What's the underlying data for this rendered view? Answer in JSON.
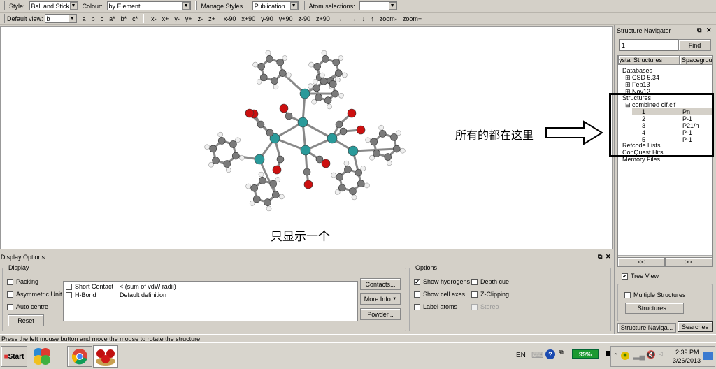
{
  "toolbar1": {
    "style_label": "Style:",
    "style_value": "Ball and Stick",
    "colour_label": "Colour:",
    "colour_value": "by Element",
    "manage_styles": "Manage Styles...",
    "manage_value": "Publication",
    "atom_sel_label": "Atom selections:",
    "atom_sel_value": ""
  },
  "toolbar2": {
    "default_view_label": "Default view:",
    "default_view_value": "b",
    "views": [
      "a",
      "b",
      "c",
      "a*",
      "b*",
      "c*"
    ],
    "rot": [
      "x-",
      "x+",
      "y-",
      "y+",
      "z-",
      "z+"
    ],
    "rot90": [
      "x-90",
      "x+90",
      "y-90",
      "y+90",
      "z-90",
      "z+90"
    ],
    "arrows": [
      "←",
      "→",
      "↓",
      "↑"
    ],
    "zoom": [
      "zoom-",
      "zoom+"
    ]
  },
  "annotations": {
    "right_note": "所有的都在这里",
    "bottom_note": "只显示一个"
  },
  "navigator": {
    "title": "Structure Navigator",
    "search_value": "1",
    "find": "Find",
    "col1": "ystal Structures",
    "col2": "Spacegroup",
    "databases": "Databases",
    "db_items": [
      "CSD 5.34",
      "Feb13",
      "Nov12"
    ],
    "structures": "Structures",
    "file": "combined cif.cif",
    "rows": [
      {
        "id": "1",
        "sg": "Pn"
      },
      {
        "id": "2",
        "sg": "P-1"
      },
      {
        "id": "3",
        "sg": "P21/n"
      },
      {
        "id": "4",
        "sg": "P-1"
      },
      {
        "id": "5",
        "sg": "P-1"
      }
    ],
    "refcode": "Refcode Lists",
    "conquest": "ConQuest Hits",
    "memory": "Memory Files",
    "prev": "<<",
    "next": ">>",
    "tree_view": "Tree View",
    "multiple": "Multiple Structures",
    "structures_btn": "Structures...",
    "tab1": "Structure Naviga...",
    "tab2": "Searches"
  },
  "display_options": {
    "title": "Display Options",
    "display_group": "Display",
    "packing": "Packing",
    "asym": "Asymmetric Unit",
    "auto_centre": "Auto centre",
    "reset": "Reset",
    "contacts": [
      {
        "name": "Short Contact",
        "def": "< (sum of vdW radii)"
      },
      {
        "name": "H-Bond",
        "def": "Default definition"
      }
    ],
    "contacts_btn": "Contacts...",
    "more_info": "More Info",
    "powder": "Powder...",
    "options_group": "Options",
    "show_h": "Show hydrogens",
    "depth": "Depth cue",
    "cell_axes": "Show cell axes",
    "zclip": "Z-Clipping",
    "label_atoms": "Label atoms",
    "stereo": "Stereo"
  },
  "status": "Press the left mouse button and move the mouse to rotate the structure",
  "taskbar": {
    "start": "Start",
    "lang": "EN",
    "battery": "99%",
    "time": "2:39 PM",
    "date": "3/26/2013"
  },
  "colors": {
    "carbon": "#7a7a7a",
    "oxygen": "#cc1010",
    "metal": "#2a9a9a",
    "hydrogen": "#f0f0f0",
    "battery": "#1a9a30"
  }
}
